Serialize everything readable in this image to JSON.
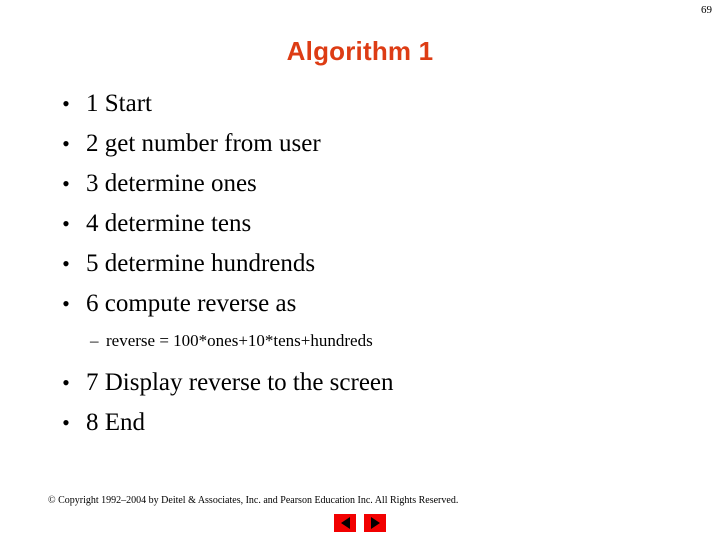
{
  "slide": {
    "page_number": "69",
    "title": "Algorithm 1",
    "title_color": "#dd3c14",
    "background_color": "#ffffff"
  },
  "content": {
    "bullets": [
      {
        "marker": "•",
        "text": "1 Start"
      },
      {
        "marker": "•",
        "text": "2 get number from user"
      },
      {
        "marker": "•",
        "text": "3 determine ones"
      },
      {
        "marker": "•",
        "text": "4 determine tens"
      },
      {
        "marker": "•",
        "text": "5 determine hundrends"
      },
      {
        "marker": "•",
        "text": "6 compute reverse as"
      }
    ],
    "sub_bullet": {
      "marker": "–",
      "text": "reverse = 100*ones+10*tens+hundreds"
    },
    "bullets_after_sub": [
      {
        "marker": "•",
        "text": "7 Display reverse to the screen"
      },
      {
        "marker": "•",
        "text": "8 End"
      }
    ]
  },
  "footer": {
    "copyright": "© Copyright 1992–2004 by Deitel & Associates, Inc. and Pearson Education Inc. All Rights Reserved.",
    "nav": {
      "previous_label": "◀",
      "next_label": "▶",
      "button_color": "#f20000",
      "arrow_color": "#000000"
    }
  }
}
